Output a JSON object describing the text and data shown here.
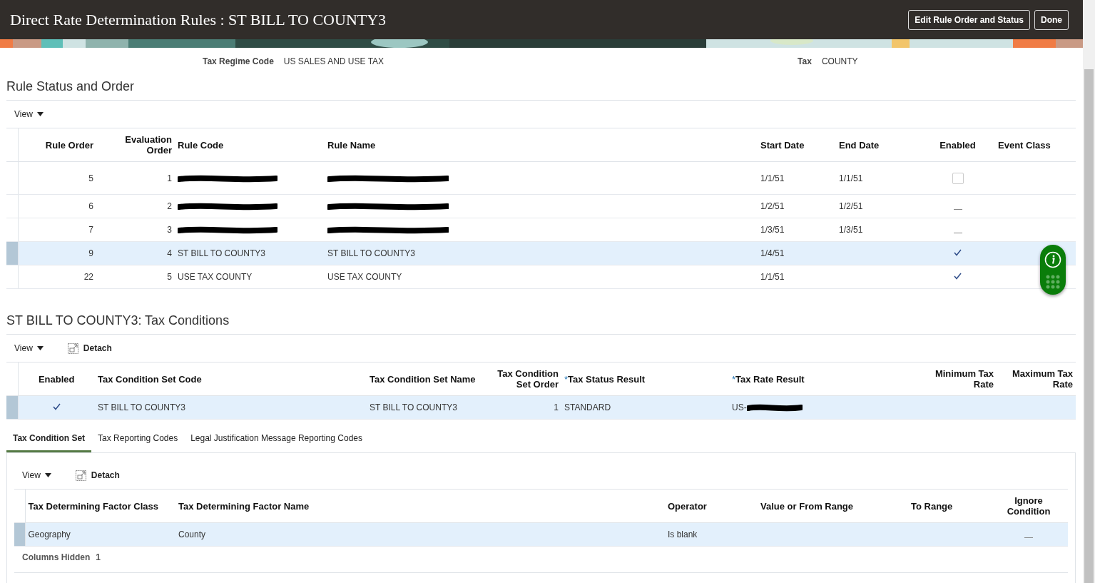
{
  "header": {
    "title": "Direct Rate Determination Rules : ST BILL TO COUNTY3",
    "buttons": [
      {
        "label": "Edit Rule Order and Status"
      },
      {
        "label": "Done"
      }
    ]
  },
  "summary": [
    {
      "label": "Tax Regime Code",
      "value": "US SALES AND USE TAX"
    },
    {
      "label": "Tax",
      "value": "COUNTY"
    }
  ],
  "rules_section": {
    "title": "Rule Status and Order",
    "toolbar": {
      "view": "View"
    },
    "columns": [
      "Rule Order",
      "Evaluation Order",
      "Rule Code",
      "Rule Name",
      "Start Date",
      "End Date",
      "Enabled",
      "Event Class"
    ],
    "rows": [
      {
        "rule_order": "5",
        "evaluation_order": "1",
        "rule_code": {
          "redacted": true
        },
        "rule_name": {
          "redacted": true
        },
        "start_date": "1/1/51",
        "end_date": "1/1/51",
        "enabled": false,
        "kind": "checkbox",
        "selected": false
      },
      {
        "rule_order": "6",
        "evaluation_order": "2",
        "rule_code": {
          "redacted": true
        },
        "rule_name": {
          "redacted": true
        },
        "start_date": "1/2/51",
        "end_date": "1/2/51",
        "enabled": false,
        "kind": "readonly",
        "selected": false
      },
      {
        "rule_order": "7",
        "evaluation_order": "3",
        "rule_code": {
          "redacted": true
        },
        "rule_name": {
          "redacted": true
        },
        "start_date": "1/3/51",
        "end_date": "1/3/51",
        "enabled": false,
        "kind": "readonly",
        "selected": false
      },
      {
        "rule_order": "9",
        "evaluation_order": "4",
        "rule_code": {
          "text": "ST BILL TO COUNTY3"
        },
        "rule_name": {
          "text": "ST BILL TO COUNTY3"
        },
        "start_date": "1/4/51",
        "enabled": true,
        "kind": "readonly",
        "selected": true
      },
      {
        "rule_order": "22",
        "evaluation_order": "5",
        "rule_code": {
          "text": "USE TAX COUNTY"
        },
        "rule_name": {
          "text": "USE TAX COUNTY"
        },
        "start_date": "1/1/51",
        "enabled": true,
        "kind": "readonly",
        "selected": false
      }
    ]
  },
  "conditions_section": {
    "title": "ST BILL TO COUNTY3: Tax Conditions",
    "toolbar": {
      "view": "View",
      "detach": "Detach"
    },
    "columns": [
      {
        "label": "Enabled"
      },
      {
        "label": "Tax Condition Set Code"
      },
      {
        "label": "Tax Condition Set Name"
      },
      {
        "label": "Tax Condition Set Order"
      },
      {
        "label": "Tax Status Result",
        "required_mark": "*"
      },
      {
        "label": "Tax Rate Result",
        "required_mark": "*"
      },
      {
        "label": "Minimum Tax Rate"
      },
      {
        "label": "Maximum Tax Rate"
      }
    ],
    "rows": [
      {
        "enabled": true,
        "code": "ST BILL TO COUNTY3",
        "name": "ST BILL TO COUNTY3",
        "order": "1",
        "status_result": "STANDARD",
        "rate_result": {
          "text": "US-",
          "redacted": true
        },
        "selected": true
      }
    ]
  },
  "tabs": [
    {
      "label": "Tax Condition Set",
      "selected": true
    },
    {
      "label": "Tax Reporting Codes",
      "selected": false
    },
    {
      "label": "Legal Justification Message Reporting Codes",
      "selected": false
    }
  ],
  "factors": {
    "toolbar": {
      "view": "View",
      "detach": "Detach"
    },
    "columns": [
      "Tax Determining Factor Class",
      "Tax Determining Factor Name",
      "Operator",
      "Value or From Range",
      "To Range",
      "Ignore Condition"
    ],
    "rows": [
      {
        "class": "Geography",
        "name": "County",
        "operator": "Is blank",
        "ignore_condition": false,
        "selected": true
      }
    ],
    "columns_hidden": {
      "label": "Columns Hidden",
      "count": "1"
    }
  }
}
